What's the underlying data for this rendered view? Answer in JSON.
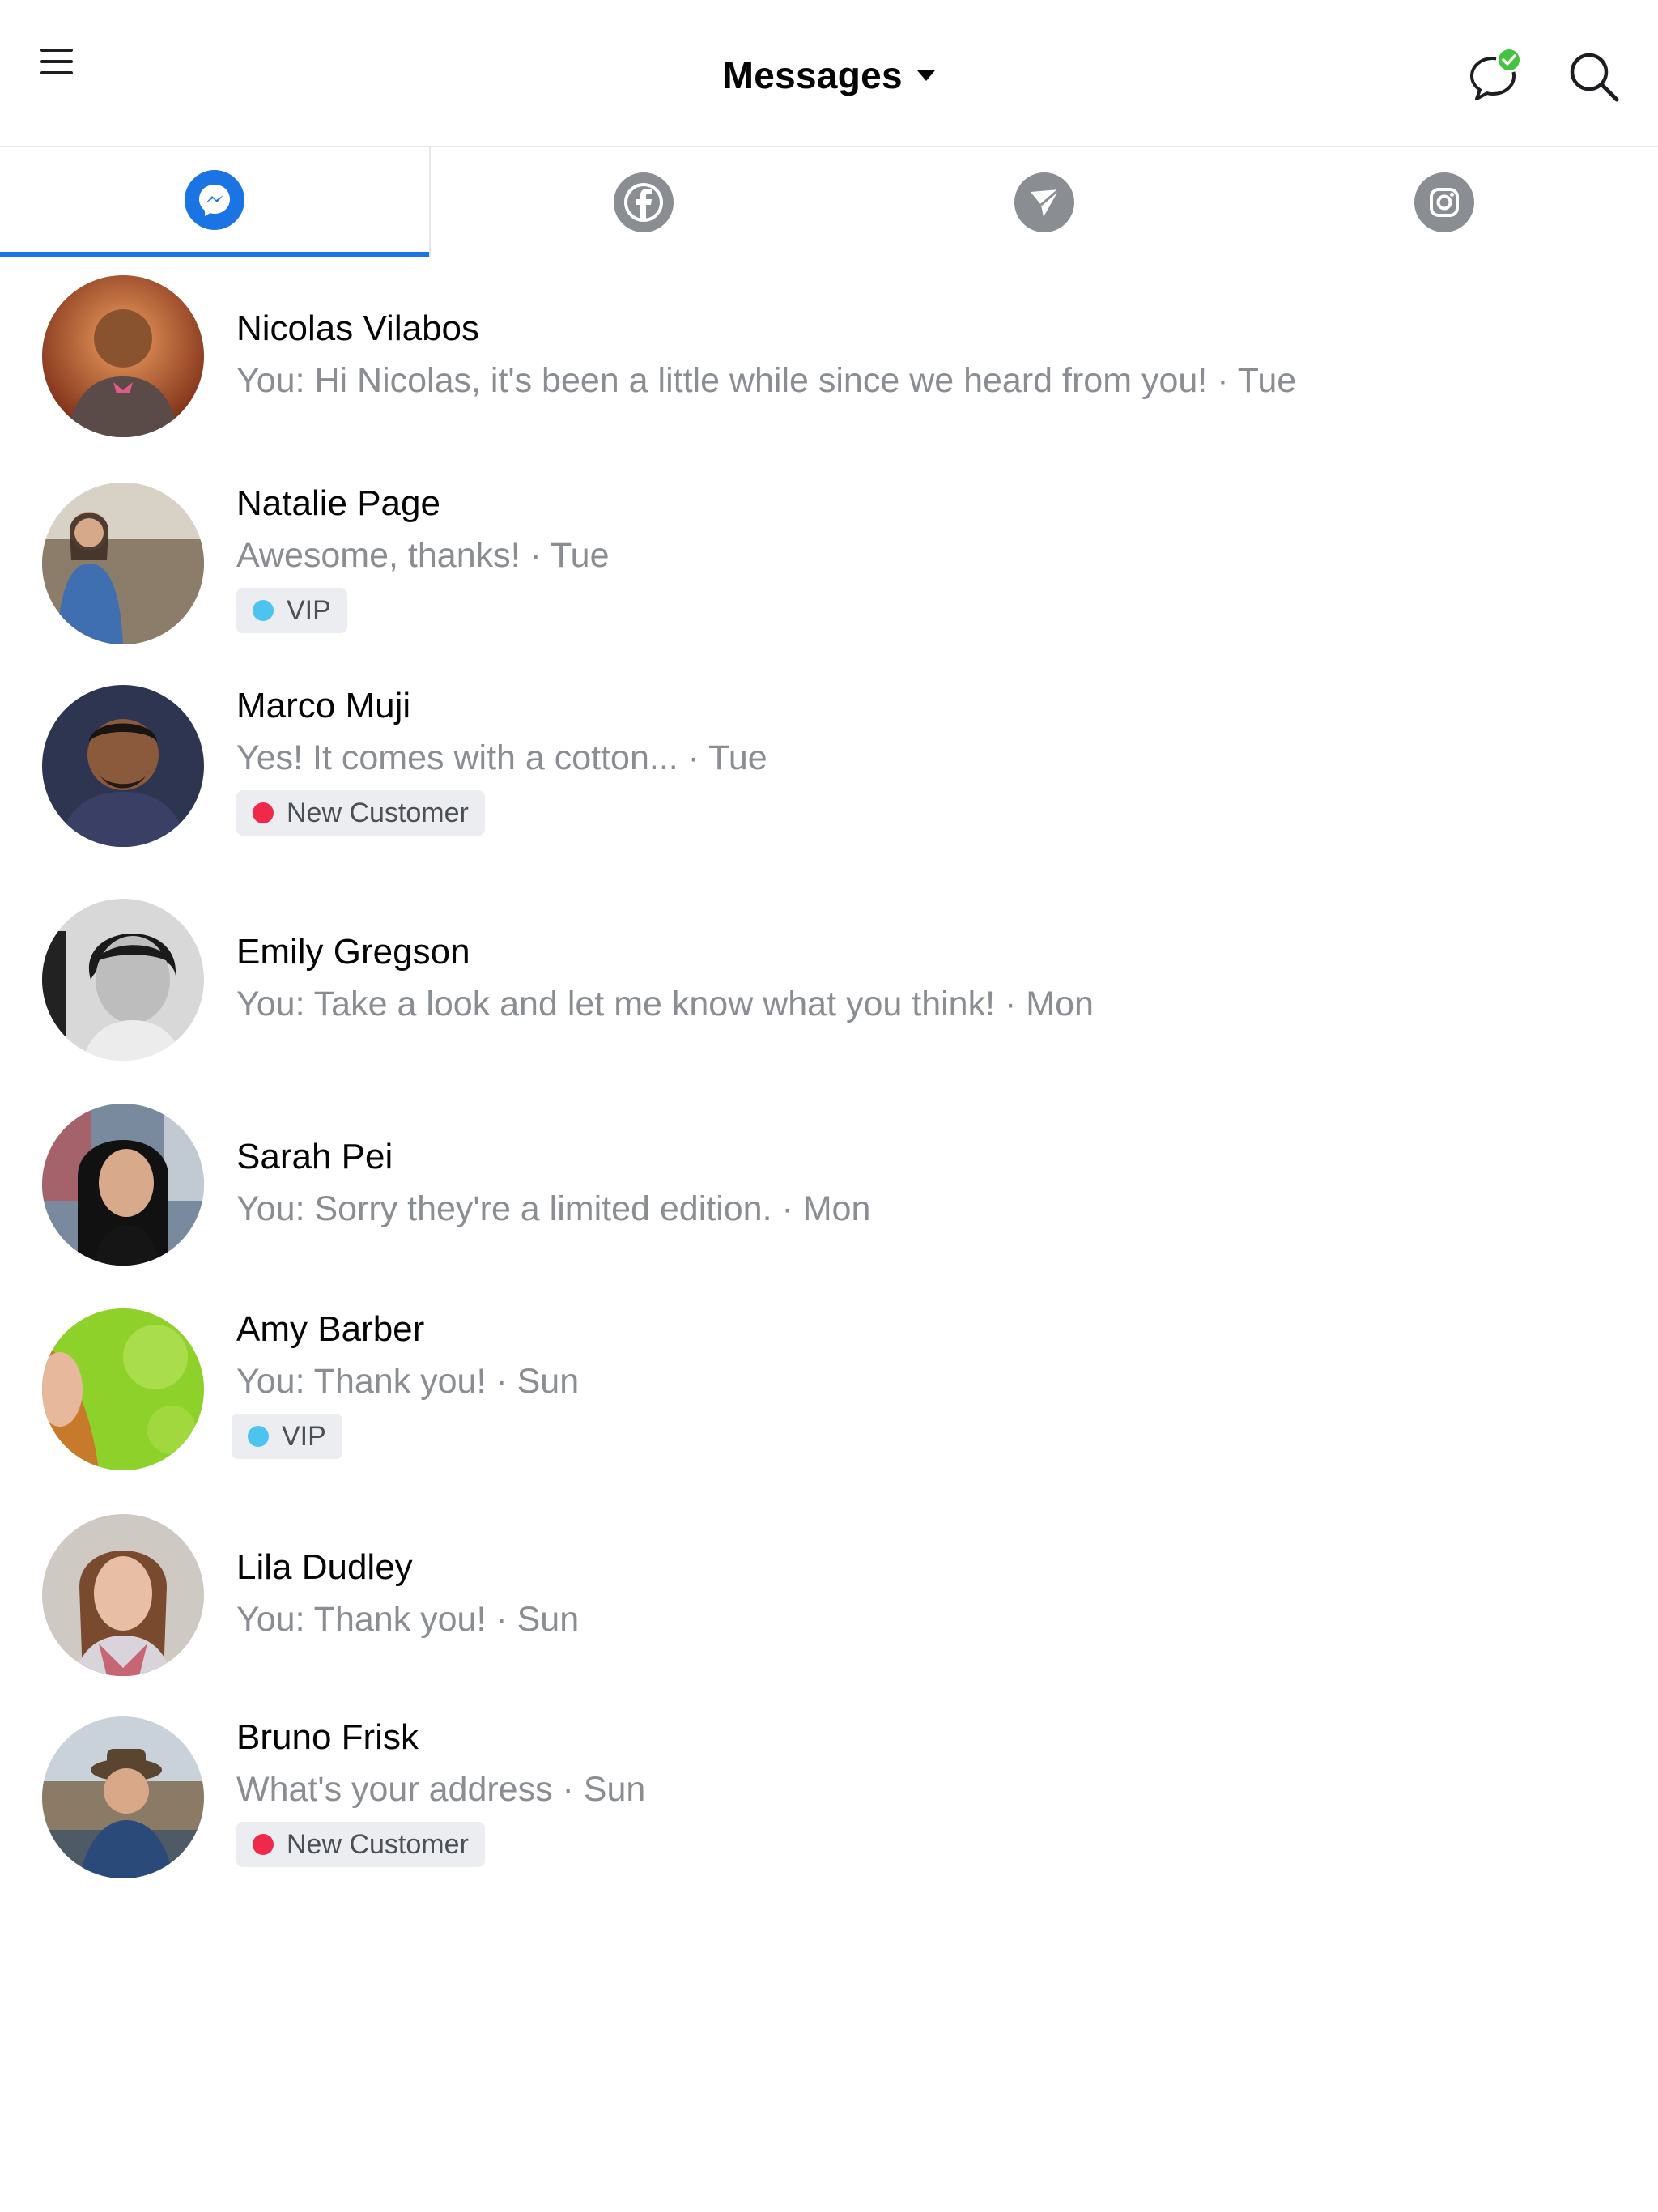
{
  "header": {
    "title": "Messages",
    "menu_icon": "hamburger-menu-icon",
    "status_icon": "chat-bubble-check-icon",
    "search_icon": "search-icon",
    "status_color": "#44c33e"
  },
  "tabs": [
    {
      "id": "messenger",
      "icon": "messenger-icon",
      "active": true,
      "color": "#1b74e4"
    },
    {
      "id": "facebook",
      "icon": "facebook-icon",
      "active": false,
      "color": "#8a8d91"
    },
    {
      "id": "direct",
      "icon": "direct-send-icon",
      "active": false,
      "color": "#8a8d91"
    },
    {
      "id": "instagram",
      "icon": "instagram-icon",
      "active": false,
      "color": "#8a8d91"
    }
  ],
  "conversations": [
    {
      "name": "Nicolas Vilabos",
      "snippet": "You: Hi Nicolas, it's been a little while since we heard from you! · Tue",
      "tag": null
    },
    {
      "name": "Natalie Page",
      "snippet": "Awesome, thanks!  · Tue",
      "tag": {
        "label": "VIP",
        "color": "#4dc3f0"
      }
    },
    {
      "name": "Marco Muji",
      "snippet": "Yes! It comes with a cotton...  · Tue",
      "tag": {
        "label": "New Customer",
        "color": "#f0284a"
      }
    },
    {
      "name": "Emily Gregson",
      "snippet": "You: Take a look and let me know what you think! · Mon",
      "tag": null
    },
    {
      "name": "Sarah Pei",
      "snippet": "You: Sorry they're a limited edition. · Mon",
      "tag": null
    },
    {
      "name": "Amy Barber",
      "snippet": "You: Thank you! · Sun",
      "tag": {
        "label": "VIP",
        "color": "#4dc3f0"
      }
    },
    {
      "name": "Lila Dudley",
      "snippet": "You: Thank you! · Sun",
      "tag": null
    },
    {
      "name": "Bruno Frisk",
      "snippet": "What's your address · Sun",
      "tag": {
        "label": "New Customer",
        "color": "#f0284a"
      }
    }
  ]
}
